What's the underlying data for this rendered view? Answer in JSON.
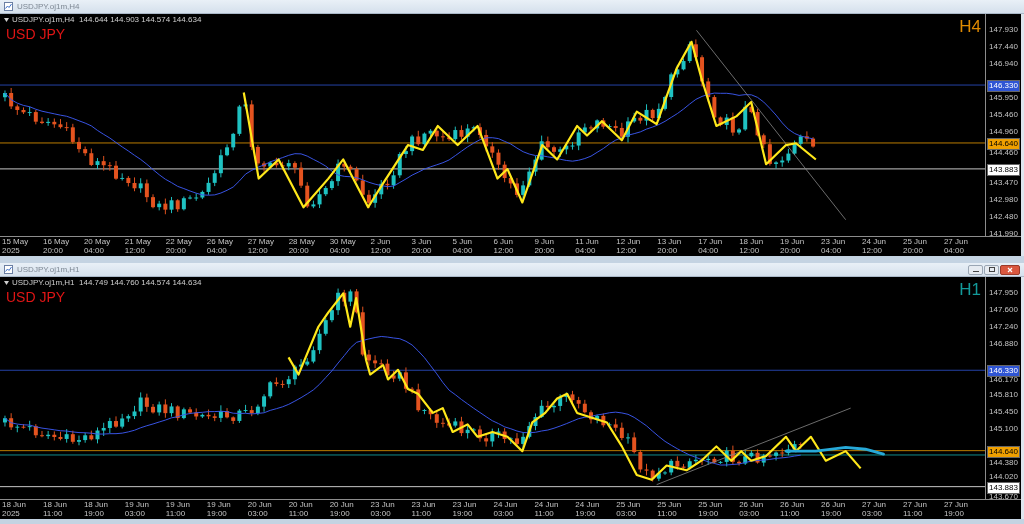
{
  "windows": [
    {
      "title": "USDJPY.oj1m,H4",
      "window_buttons": false,
      "header": "USDJPY.oj1m,H4  144.644 144.903 144.574 144.634",
      "symbol": "USD JPY",
      "timeframe": {
        "text": "H4",
        "color": "#e08a00"
      },
      "price_ticks": [
        "147.930",
        "147.440",
        "146.940",
        "145.950",
        "145.460",
        "144.960",
        "144.460",
        "143.470",
        "142.980",
        "142.480",
        "141.990"
      ],
      "price_markers": [
        {
          "price": "146.330",
          "color": "#2f55d4"
        },
        {
          "price": "144.640",
          "color": "#f0a000"
        },
        {
          "price": "143.883",
          "color": "#ffffff"
        }
      ],
      "time_labels": [
        "15 May 2025",
        "16 May 20:00",
        "20 May 04:00",
        "21 May 12:00",
        "22 May 20:00",
        "26 May 04:00",
        "27 May 12:00",
        "28 May 20:00",
        "30 May 04:00",
        "2 Jun 12:00",
        "3 Jun 20:00",
        "5 Jun 04:00",
        "6 Jun 12:00",
        "9 Jun 20:00",
        "11 Jun 04:00",
        "12 Jun 12:00",
        "13 Jun 20:00",
        "17 Jun 04:00",
        "18 Jun 12:00",
        "19 Jun 20:00",
        "23 Jun 04:00",
        "24 Jun 12:00",
        "25 Jun 20:00",
        "27 Jun 04:00"
      ]
    },
    {
      "title": "USDJPY.oj1m,H1",
      "window_buttons": true,
      "header": "USDJPY.oj1m,H1  144.749 144.760 144.574 144.634",
      "symbol": "USD JPY",
      "timeframe": {
        "text": "H1",
        "color": "#139a9a"
      },
      "price_ticks": [
        "147.950",
        "147.600",
        "147.240",
        "146.880",
        "146.170",
        "145.810",
        "145.450",
        "145.100",
        "144.380",
        "144.020",
        "143.670"
      ],
      "price_markers": [
        {
          "price": "146.330",
          "color": "#2f55d4"
        },
        {
          "price": "144.640",
          "color": "#f0a000"
        },
        {
          "price": "143.883",
          "color": "#ffffff"
        }
      ],
      "time_labels": [
        "18 Jun 2025",
        "18 Jun 11:00",
        "18 Jun 19:00",
        "19 Jun 03:00",
        "19 Jun 11:00",
        "19 Jun 19:00",
        "20 Jun 03:00",
        "20 Jun 11:00",
        "20 Jun 19:00",
        "23 Jun 03:00",
        "23 Jun 11:00",
        "23 Jun 19:00",
        "24 Jun 03:00",
        "24 Jun 11:00",
        "24 Jun 19:00",
        "25 Jun 03:00",
        "25 Jun 11:00",
        "25 Jun 19:00",
        "26 Jun 03:00",
        "26 Jun 11:00",
        "26 Jun 19:00",
        "27 Jun 03:00",
        "27 Jun 11:00",
        "27 Jun 19:00"
      ]
    }
  ]
}
